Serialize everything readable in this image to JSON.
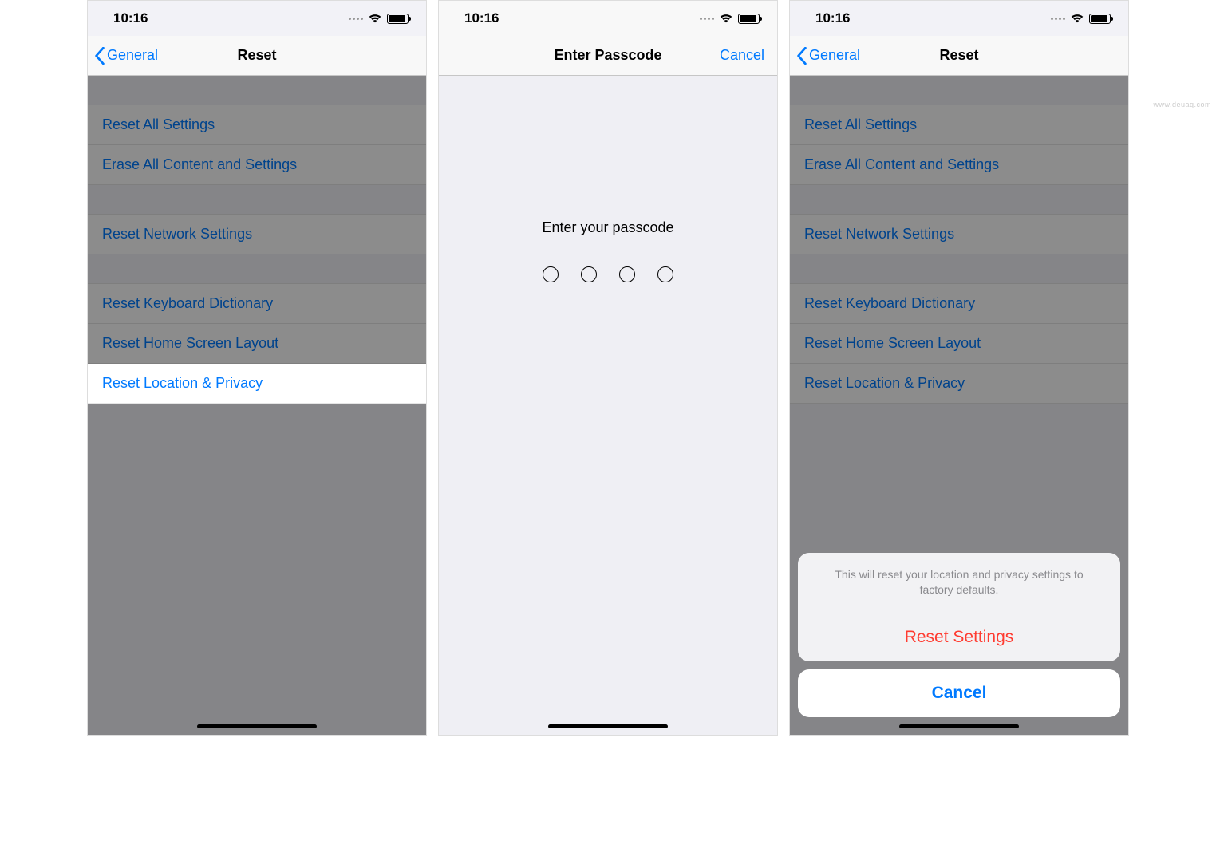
{
  "status": {
    "time": "10:16"
  },
  "screen1": {
    "back_label": "General",
    "title": "Reset",
    "items": {
      "reset_all": "Reset All Settings",
      "erase_all": "Erase All Content and Settings",
      "reset_network": "Reset Network Settings",
      "reset_keyboard": "Reset Keyboard Dictionary",
      "reset_home": "Reset Home Screen Layout",
      "reset_location": "Reset Location & Privacy"
    }
  },
  "screen2": {
    "title": "Enter Passcode",
    "cancel_label": "Cancel",
    "prompt": "Enter your passcode"
  },
  "screen3": {
    "back_label": "General",
    "title": "Reset",
    "items": {
      "reset_all": "Reset All Settings",
      "erase_all": "Erase All Content and Settings",
      "reset_network": "Reset Network Settings",
      "reset_keyboard": "Reset Keyboard Dictionary",
      "reset_home": "Reset Home Screen Layout",
      "reset_location": "Reset Location & Privacy"
    },
    "sheet": {
      "message": "This will reset your location and privacy settings to factory defaults.",
      "action_label": "Reset Settings",
      "cancel_label": "Cancel"
    }
  },
  "watermark": "www.deuaq.com"
}
